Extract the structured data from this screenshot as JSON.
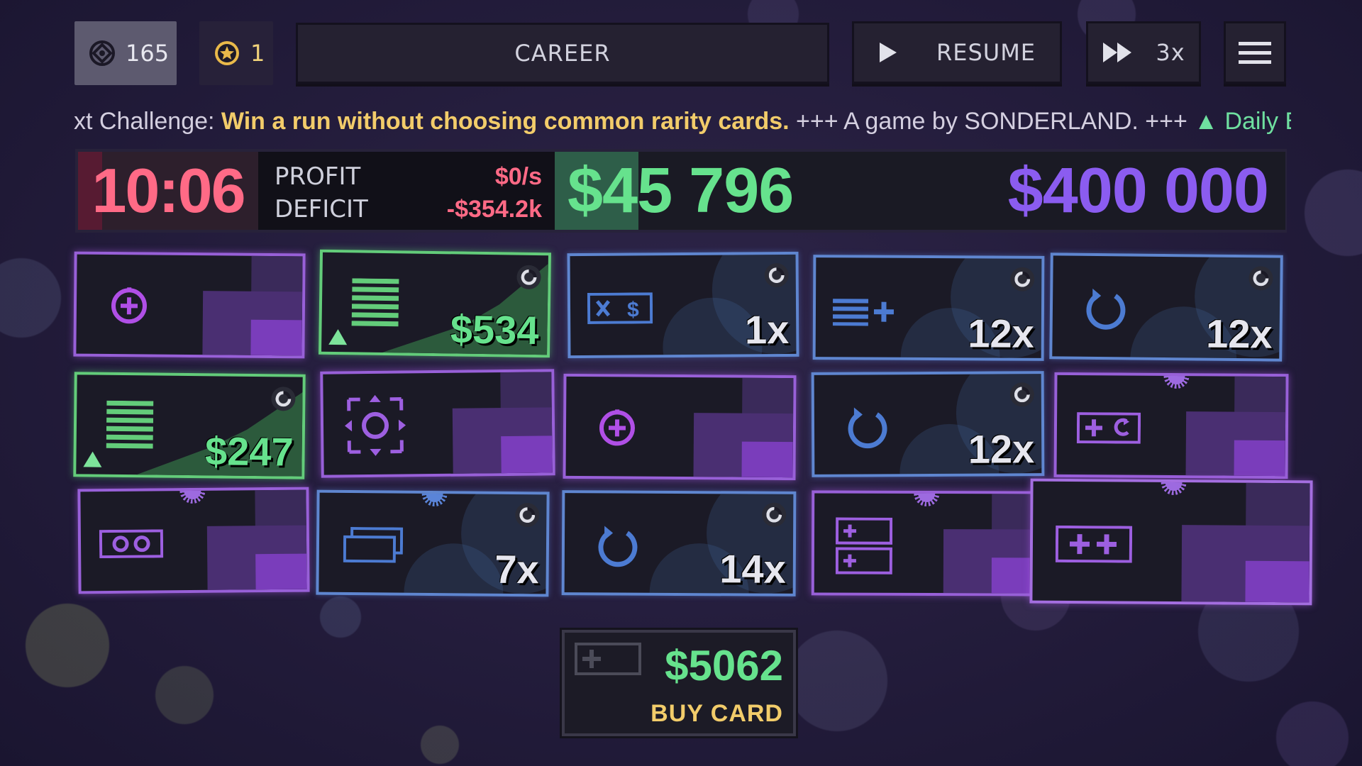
{
  "top_bar": {
    "currency_count": "165",
    "star_count": "1",
    "mode_label": "CAREER",
    "resume_label": "RESUME",
    "speed_label": "3x"
  },
  "ticker": {
    "prefix": "xt Challenge: ",
    "challenge": "Win a run without choosing common rarity cards.",
    "middle": " +++ A game by SONDERLAND. +++ ",
    "tail": "Daily Bull:"
  },
  "status": {
    "timer": "10:06",
    "profit_label": "PROFIT",
    "deficit_label": "DEFICIT",
    "profit_value": "$0/s",
    "deficit_value": "-$354.2k",
    "balance": "$45 796",
    "goal": "$400 000",
    "balance_progress_fraction": 0.115
  },
  "cards": [
    {
      "name": "card-add-slot",
      "value": ""
    },
    {
      "name": "card-income-1",
      "value": "$534"
    },
    {
      "name": "card-multiply-dollar",
      "value": "1x"
    },
    {
      "name": "card-list-add",
      "value": "12x"
    },
    {
      "name": "card-refresh-1",
      "value": "12x"
    },
    {
      "name": "card-income-2",
      "value": "$247"
    },
    {
      "name": "card-expand-arrows",
      "value": ""
    },
    {
      "name": "card-add-slot-2",
      "value": ""
    },
    {
      "name": "card-refresh-2",
      "value": "12x"
    },
    {
      "name": "card-add-refresh",
      "value": ""
    },
    {
      "name": "card-double-loop",
      "value": ""
    },
    {
      "name": "card-bill-stack",
      "value": "7x"
    },
    {
      "name": "card-refresh-3",
      "value": "14x"
    },
    {
      "name": "card-double-plus",
      "value": ""
    },
    {
      "name": "card-plus-plus",
      "value": ""
    }
  ],
  "buy_card": {
    "price": "$5062",
    "label": "BUY CARD"
  },
  "colors": {
    "money_green": "#66e28d",
    "goal_purple": "#8b5cf0",
    "timer_red": "#ff6a86",
    "ticker_yellow": "#f2cc6a"
  }
}
